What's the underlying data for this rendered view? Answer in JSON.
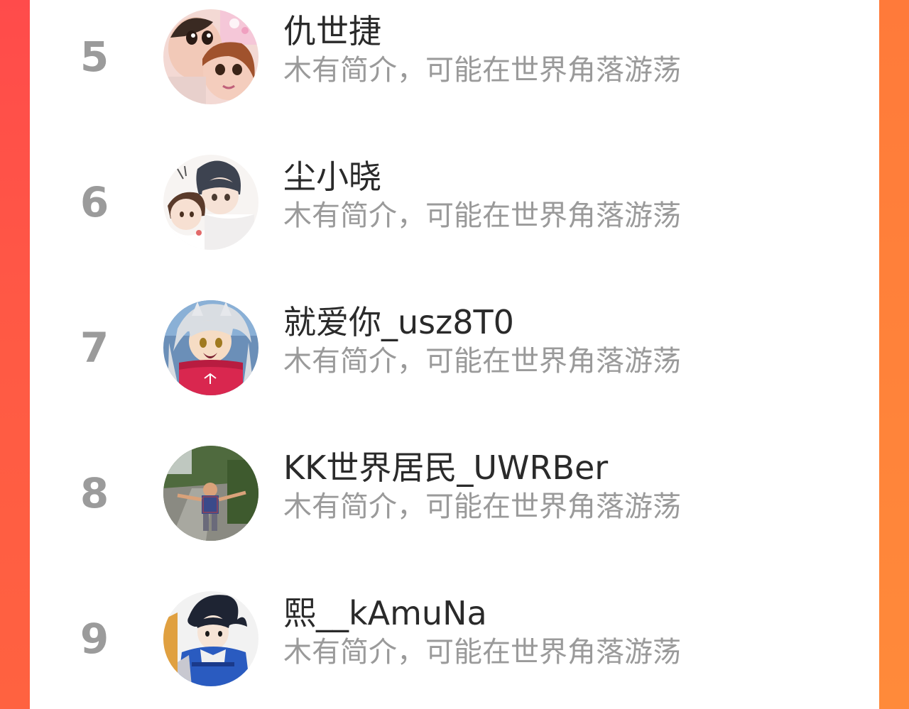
{
  "leaderboard": {
    "entries": [
      {
        "rank": "5",
        "name": "仇世捷",
        "bio": "木有简介，可能在世界角落游荡",
        "avatar": "cartoon-filter-selfie-avatar"
      },
      {
        "rank": "6",
        "name": "尘小晓",
        "bio": "木有简介，可能在世界角落游荡",
        "avatar": "anime-couple-avatar"
      },
      {
        "rank": "7",
        "name": "就爱你_usz8T0",
        "bio": "木有简介，可能在世界角落游荡",
        "avatar": "anime-character-pink-avatar"
      },
      {
        "rank": "8",
        "name": "KK世界居民_UWRBer",
        "bio": "木有简介，可能在世界角落游荡",
        "avatar": "child-outdoor-photo-avatar"
      },
      {
        "rank": "9",
        "name": "熙__kAmuNa",
        "bio": "木有简介，可能在世界角落游荡",
        "avatar": "anime-ninja-blue-avatar"
      }
    ]
  },
  "colors": {
    "background_gradient_start": "#ff4a4a",
    "background_gradient_end": "#ff8a3a",
    "panel": "#ffffff",
    "rank_text": "#9b9b9b",
    "name_text": "#2a2a2a",
    "bio_text": "#9a9a9a"
  }
}
